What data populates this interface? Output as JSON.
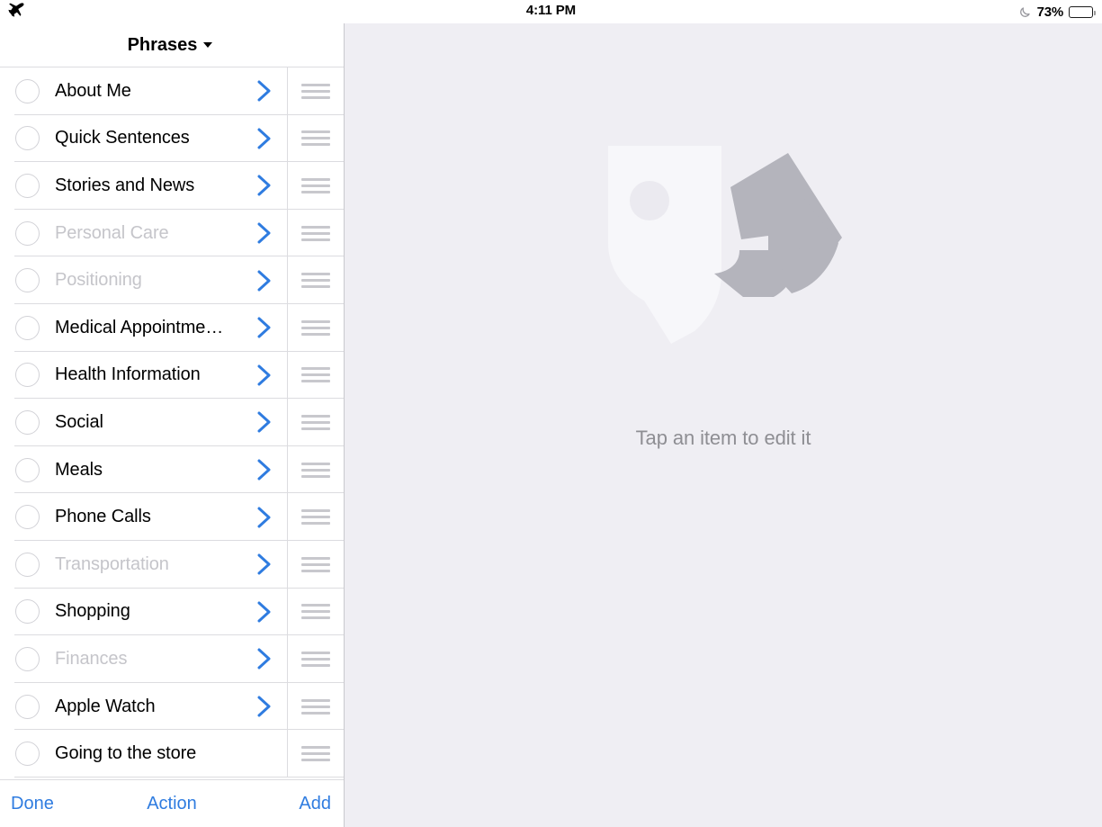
{
  "statusbar": {
    "airplane_icon": "airplane-mode-icon",
    "time": "4:11 PM",
    "dnd_icon": "moon-icon",
    "battery_percent": "73%",
    "battery_icon": "battery-icon",
    "battery_level": 73
  },
  "master": {
    "title": "Phrases",
    "caret_icon": "chevron-down-icon",
    "rows": [
      {
        "label": "About Me",
        "disabled": false,
        "chevron": true
      },
      {
        "label": "Quick Sentences",
        "disabled": false,
        "chevron": true
      },
      {
        "label": "Stories and News",
        "disabled": false,
        "chevron": true
      },
      {
        "label": "Personal Care",
        "disabled": true,
        "chevron": true
      },
      {
        "label": "Positioning",
        "disabled": true,
        "chevron": true
      },
      {
        "label": "Medical Appointme…",
        "disabled": false,
        "chevron": true
      },
      {
        "label": "Health Information",
        "disabled": false,
        "chevron": true
      },
      {
        "label": "Social",
        "disabled": false,
        "chevron": true
      },
      {
        "label": "Meals",
        "disabled": false,
        "chevron": true
      },
      {
        "label": "Phone Calls",
        "disabled": false,
        "chevron": true
      },
      {
        "label": "Transportation",
        "disabled": true,
        "chevron": true
      },
      {
        "label": "Shopping",
        "disabled": false,
        "chevron": true
      },
      {
        "label": "Finances",
        "disabled": true,
        "chevron": true
      },
      {
        "label": "Apple Watch",
        "disabled": false,
        "chevron": true
      },
      {
        "label": "Going to the store",
        "disabled": false,
        "chevron": false
      }
    ],
    "toolbar": {
      "done_label": "Done",
      "action_label": "Action",
      "add_label": "Add"
    }
  },
  "detail": {
    "logo_icon": "predictable-app-logo",
    "empty_message": "Tap an item to edit it"
  },
  "colors": {
    "accent_blue": "#2F7CE0",
    "detail_background": "#EFEEF3",
    "disabled_text": "#C5C5CA",
    "separator": "#DCDCE0",
    "logo_light": "#F7F7FA",
    "logo_dark": "#B4B4BC"
  }
}
